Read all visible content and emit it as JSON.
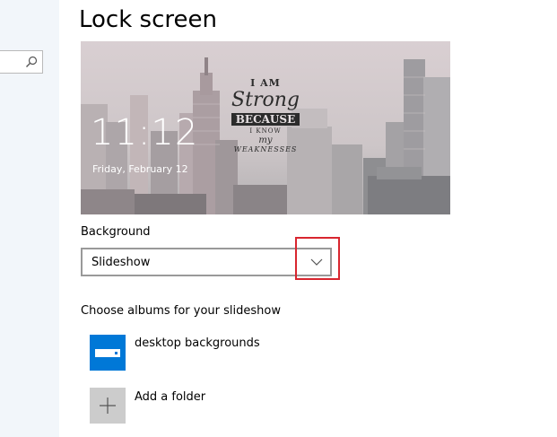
{
  "page": {
    "title": "Lock screen"
  },
  "sidebar": {
    "search_icon": "search-icon"
  },
  "preview": {
    "time": "11:12",
    "date": "Friday, February 12",
    "quote": {
      "line1": "I AM",
      "line2": "Strong",
      "line3": "BECAUSE",
      "line4": "I KNOW",
      "line5": "my",
      "line6": "WEAKNESSES"
    }
  },
  "background": {
    "label": "Background",
    "selected": "Slideshow",
    "chevron_icon": "chevron-down-icon"
  },
  "albums": {
    "label": "Choose albums for your slideshow",
    "items": [
      {
        "name": "desktop backgrounds",
        "icon": "folder-icon",
        "color": "#0078d7"
      }
    ],
    "add_label": "Add a folder",
    "add_icon": "plus-icon"
  },
  "colors": {
    "accent": "#0078d7",
    "highlight": "#d8262f",
    "sidebar_bg": "#f2f6fa"
  }
}
